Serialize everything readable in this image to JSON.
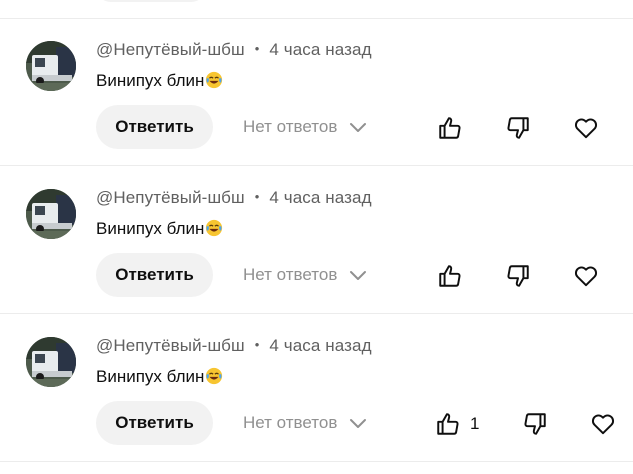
{
  "comments": [
    {
      "author": "@Непутёвый-шбш",
      "time": "4 часа назад",
      "text": "Винипух блин",
      "reply_label": "Ответить",
      "replies_label": "Нет ответов",
      "like_count": ""
    },
    {
      "author": "@Непутёвый-шбш",
      "time": "4 часа назад",
      "text": "Винипух блин",
      "reply_label": "Ответить",
      "replies_label": "Нет ответов",
      "like_count": ""
    },
    {
      "author": "@Непутёвый-шбш",
      "time": "4 часа назад",
      "text": "Винипух блин",
      "reply_label": "Ответить",
      "replies_label": "Нет ответов",
      "like_count": "1"
    }
  ],
  "meta_separator": "•",
  "emoji_name": "laughing-tears-emoji",
  "icons": [
    "like-icon",
    "dislike-icon",
    "heart-icon",
    "chevron-down-icon"
  ],
  "colors": {
    "text_primary": "#0f0f0f",
    "text_secondary": "#606060",
    "text_muted": "#909090",
    "button_bg": "#f2f2f2",
    "divider": "#ececec"
  }
}
